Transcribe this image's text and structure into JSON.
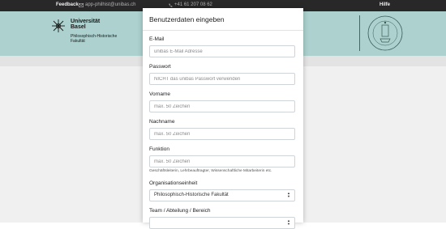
{
  "topbar": {
    "feedback": "Feedback",
    "email": "app-philhist@unibas.ch",
    "phone": "+41 61 207 08 62",
    "help": "Hilfe"
  },
  "header": {
    "university_line1": "Universität",
    "university_line2": "Basel",
    "faculty_line1": "Philosophisch-Historische",
    "faculty_line2": "Fakultät",
    "background": "#b7dfdb"
  },
  "modal": {
    "title": "Benutzerdaten eingeben",
    "fields": {
      "email": {
        "label": "E-Mail",
        "placeholder": "unibas E-Mail Adresse"
      },
      "password": {
        "label": "Passwort",
        "placeholder": "NICHT das unibas Passwort verwenden"
      },
      "firstname": {
        "label": "Vorname",
        "placeholder": "max. 50 Zeichen"
      },
      "lastname": {
        "label": "Nachname",
        "placeholder": "max. 50 Zeichen"
      },
      "function": {
        "label": "Funktion",
        "placeholder": "max. 50 Zeichen",
        "help": "Geschäftsleiterin, Lehrbeauftragter, Wissenschaftliche Mitarbeiterin etc."
      },
      "unit": {
        "label": "Organisationseinheit",
        "value": "Philosophisch-Historische Fakultät"
      },
      "team": {
        "label": "Team / Abteilung / Bereich"
      }
    }
  }
}
